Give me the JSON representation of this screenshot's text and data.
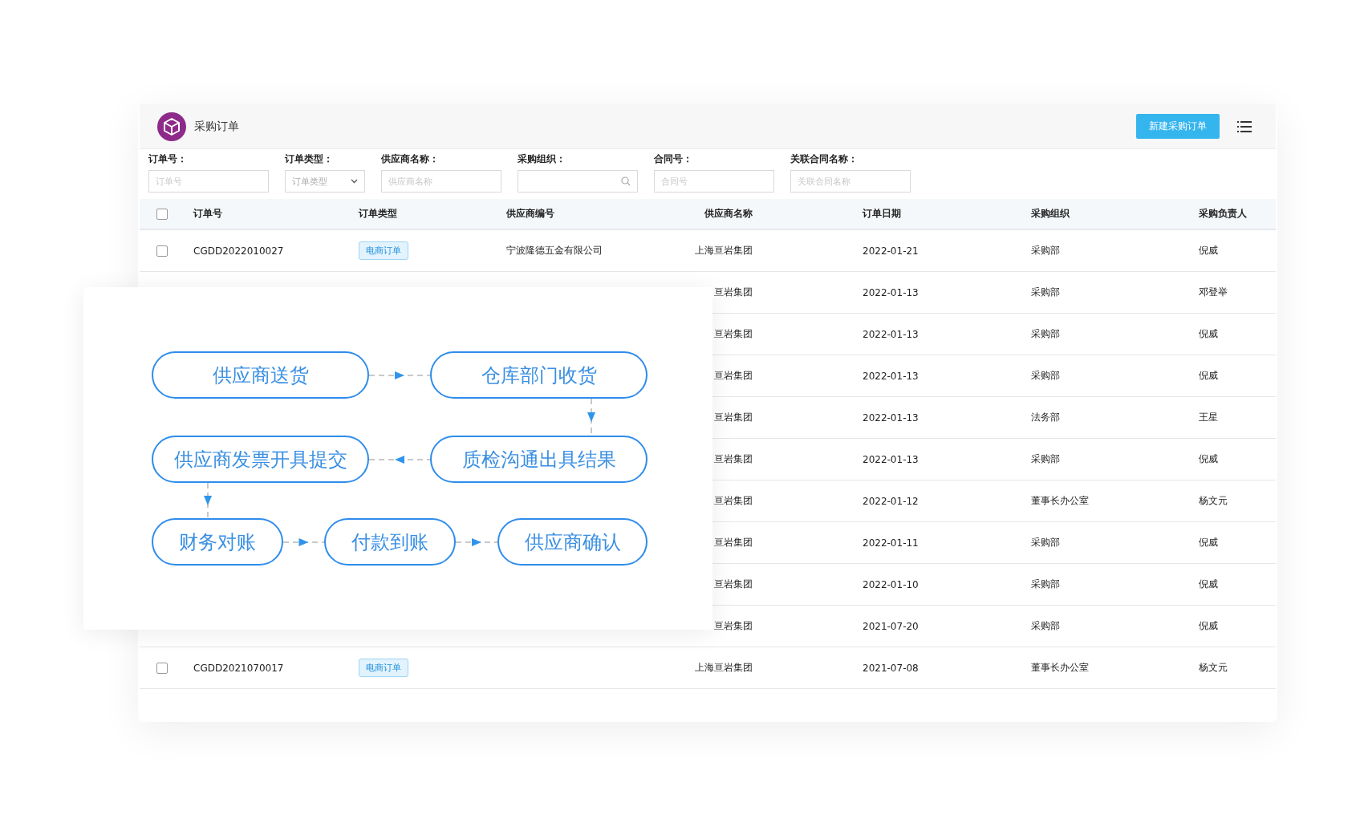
{
  "header": {
    "title": "采购订单",
    "new_button": "新建采购订单"
  },
  "filters": [
    {
      "label": "订单号：",
      "placeholder": "订单号",
      "kind": "text"
    },
    {
      "label": "订单类型：",
      "placeholder": "订单类型",
      "kind": "select"
    },
    {
      "label": "供应商名称：",
      "placeholder": "供应商名称",
      "kind": "text"
    },
    {
      "label": "采购组织：",
      "kind": "search"
    },
    {
      "label": "合同号：",
      "placeholder": "合同号",
      "kind": "text"
    },
    {
      "label": "关联合同名称：",
      "placeholder": "关联合同名称",
      "kind": "text"
    }
  ],
  "table": {
    "select_all": {
      "checked": false
    },
    "columns": [
      "订单号",
      "订单类型",
      "供应商编号",
      "供应商名称",
      "订单日期",
      "采购组织",
      "采购负责人"
    ],
    "rows": [
      {
        "checked": false,
        "order_no": "CGDD2022010027",
        "tag": {
          "text": "电商订单",
          "kind": "ecommerce"
        },
        "supplier_code": "宁波隆德五金有限公司",
        "supplier_name": "上海亘岩集团",
        "date": "2022-01-21",
        "org": "采购部",
        "owner": "倪威"
      },
      {
        "supplier_name": "亘岩集团",
        "date": "2022-01-13",
        "org": "采购部",
        "owner": "邓登举"
      },
      {
        "supplier_name": "亘岩集团",
        "date": "2022-01-13",
        "org": "采购部",
        "owner": "倪威"
      },
      {
        "supplier_name": "亘岩集团",
        "date": "2022-01-13",
        "org": "采购部",
        "owner": "倪威"
      },
      {
        "supplier_name": "亘岩集团",
        "date": "2022-01-13",
        "org": "法务部",
        "owner": "王星"
      },
      {
        "supplier_name": "亘岩集团",
        "date": "2022-01-13",
        "org": "采购部",
        "owner": "倪威"
      },
      {
        "supplier_name": "亘岩集团",
        "date": "2022-01-12",
        "org": "董事长办公室",
        "owner": "杨文元"
      },
      {
        "supplier_name": "亘岩集团",
        "date": "2022-01-11",
        "org": "采购部",
        "owner": "倪威"
      },
      {
        "supplier_name": "亘岩集团",
        "date": "2022-01-10",
        "org": "采购部",
        "owner": "倪威"
      },
      {
        "supplier_name": "亘岩集团",
        "date": "2021-07-20",
        "org": "采购部",
        "owner": "倪威"
      },
      {
        "checked": false,
        "order_no": "CGDD2021070017",
        "tag": {
          "text": "电商订单",
          "kind": "ecommerce"
        },
        "supplier_name": "上海亘岩集团",
        "date": "2021-07-08",
        "org": "董事长办公室",
        "owner": "杨文元"
      }
    ]
  },
  "flow": {
    "steps": [
      "供应商送货",
      "仓库部门收货",
      "供应商发票开具提交",
      "质检沟通出具结果",
      "财务对账",
      "付款到账",
      "供应商确认"
    ]
  }
}
